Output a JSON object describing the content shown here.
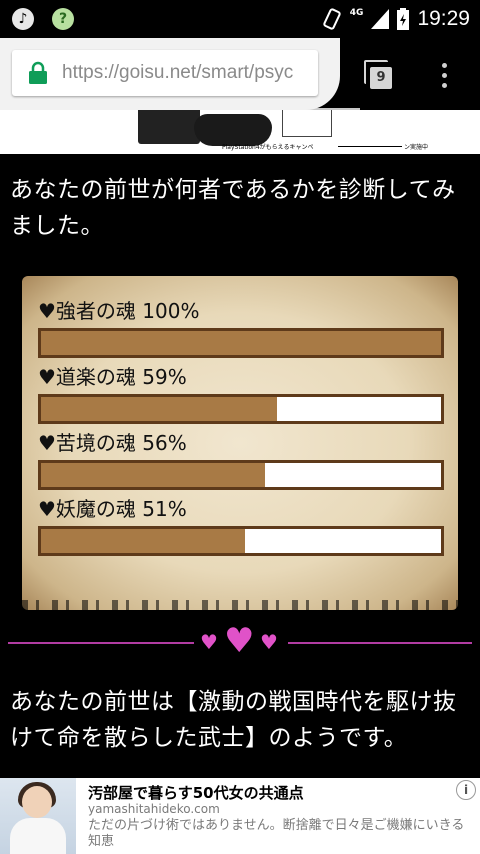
{
  "status_bar": {
    "time": "19:29",
    "network": "4G",
    "left_icons": [
      "music-icon",
      "search-help-icon"
    ],
    "right_icons": [
      "rotate-icon",
      "signal-icon",
      "battery-icon"
    ]
  },
  "browser": {
    "url": "https://goisu.net/smart/psyc",
    "tab_count": "9",
    "secure": true
  },
  "banner": {
    "caption": "PlayStation4がもらえるキャンペ",
    "caption_end": "ン実施中"
  },
  "intro_text": "あなたの前世が何者であるかを診断してみました。",
  "stats": [
    {
      "label": "♥強者の魂 100%",
      "fraction": 1.0
    },
    {
      "label": "♥道楽の魂 59%",
      "fraction": 0.59
    },
    {
      "label": "♥苦境の魂 56%",
      "fraction": 0.56
    },
    {
      "label": "♥妖魔の魂 51%",
      "fraction": 0.51
    }
  ],
  "result_text": "あなたの前世は【激動の戦国時代を駆け抜けて命を散らした武士】のようです。",
  "ad": {
    "title": "汚部屋で暮らす50代女の共通点",
    "domain": "yamashitahideko.com",
    "description": "ただの片づけ術ではありません。断捨離で日々是ご機嫌にいきる知恵"
  },
  "colors": {
    "bar_fill": "#a87a45",
    "bar_border": "#5e3a1a",
    "accent_pink": "#e052c8",
    "divider": "#b23ca3"
  }
}
